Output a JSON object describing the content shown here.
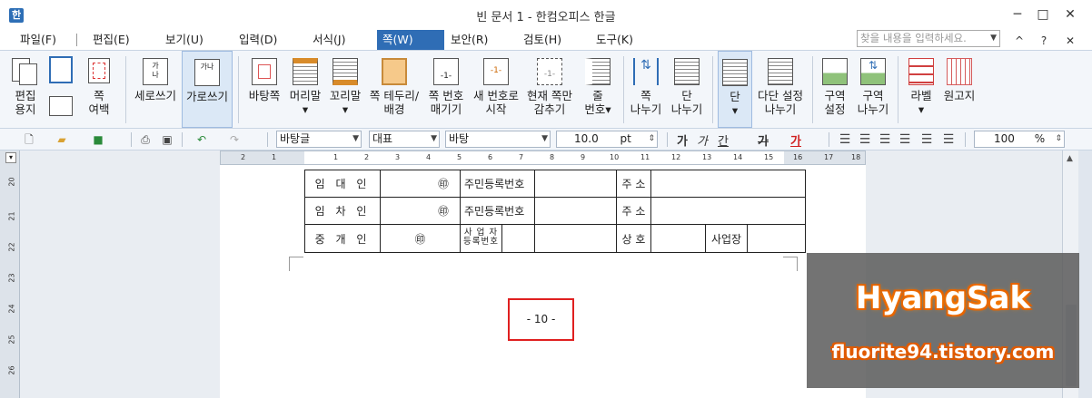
{
  "window": {
    "title": "빈 문서 1 - 한컴오피스 한글",
    "app_icon": "hwp-app-icon",
    "controls": {
      "minimize": "─",
      "maximize": "□",
      "close": "✕"
    }
  },
  "menu": {
    "items": [
      "파일(F)",
      "편집(E)",
      "보기(U)",
      "입력(D)",
      "서식(J)",
      "쪽(W)",
      "보안(R)",
      "검토(H)",
      "도구(K)"
    ],
    "active": "쪽(W)",
    "search_placeholder": "찾을 내용을 입력하세요.",
    "right_icons": {
      "collapse": "^",
      "help": "?",
      "close": "✕"
    }
  },
  "ribbon": {
    "buttons": [
      {
        "id": "edit-paper",
        "label": "편집\n용지"
      },
      {
        "id": "page-margin",
        "label": "쪽\n여백"
      },
      {
        "id": "portrait",
        "label": "세로쓰기"
      },
      {
        "id": "landscape",
        "label": "가로쓰기"
      },
      {
        "id": "base-page",
        "label": "바탕쪽"
      },
      {
        "id": "header",
        "label": "머리말"
      },
      {
        "id": "footer",
        "label": "꼬리말"
      },
      {
        "id": "page-border",
        "label": "쪽 테두리/\n배경"
      },
      {
        "id": "page-number-hide",
        "label": "쪽 번호\n매기기"
      },
      {
        "id": "new-number",
        "label": "새 번호로\n시작"
      },
      {
        "id": "hide-current",
        "label": "현재 쪽만\n감추기"
      },
      {
        "id": "line-number",
        "label": "줄\n번호"
      },
      {
        "id": "page-break",
        "label": "쪽\n나누기"
      },
      {
        "id": "column-break",
        "label": "단\n나누기"
      },
      {
        "id": "column",
        "label": "단"
      },
      {
        "id": "multi-column",
        "label": "다단 설정\n나누기"
      },
      {
        "id": "section-setup",
        "label": "구역\n설정"
      },
      {
        "id": "section-break",
        "label": "구역\n나누기"
      },
      {
        "id": "label",
        "label": "라벨"
      },
      {
        "id": "manuscript",
        "label": "원고지"
      }
    ]
  },
  "format_bar": {
    "style": "바탕글",
    "font_lang": "대표",
    "font": "바탕",
    "size": "10.0",
    "size_unit": "pt",
    "zoom": "100",
    "zoom_unit": "%",
    "bold": "가",
    "italic": "가",
    "underline": "간",
    "strike": "가",
    "color": "가"
  },
  "ruler": {
    "top_numbers": [
      "2",
      "1",
      "1",
      "2",
      "3",
      "4",
      "5",
      "6",
      "7",
      "8",
      "9",
      "10",
      "11",
      "12",
      "13",
      "14",
      "15",
      "16",
      "17",
      "18"
    ],
    "left_numbers": [
      "20",
      "21",
      "22",
      "23",
      "24",
      "25",
      "26"
    ]
  },
  "document": {
    "rows": [
      {
        "label": "임 대 인",
        "seal": "㊞",
        "reg_label": "주민등록번호",
        "addr_label": "주 소"
      },
      {
        "label": "임 차 인",
        "seal": "㊞",
        "reg_label": "주민등록번호",
        "addr_label": "주 소"
      },
      {
        "label": "중 개 인",
        "seal": "㊞",
        "biz_reg_label_1": "사 업 자",
        "biz_reg_label_2": "등록번호",
        "trade_label": "상 호",
        "biz_place_label": "사업장"
      }
    ],
    "page_number": "- 10 -"
  },
  "watermark": {
    "title": "HyangSak",
    "url": "fluorite94.tistory.com"
  },
  "colors": {
    "accent": "#2f6db5",
    "highlight_box": "#e02020",
    "watermark_glow": "#e05a00"
  }
}
